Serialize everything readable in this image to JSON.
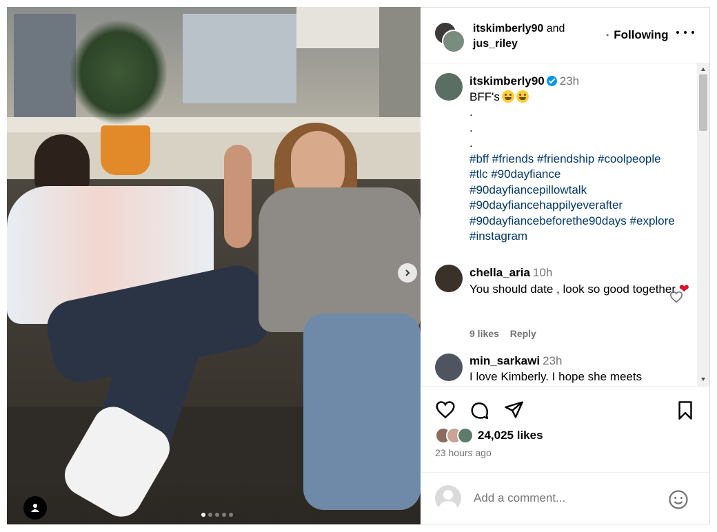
{
  "header": {
    "user1": "itskimberly90",
    "conj": "and",
    "user2": "jus_riley",
    "follow_label": "Following"
  },
  "caption": {
    "username": "itskimberly90",
    "time": "23h",
    "text": "BFF's",
    "dots": [
      ".",
      ".",
      "."
    ],
    "hashtags": [
      "#bff",
      "#friends",
      "#friendship",
      "#coolpeople",
      "#tlc",
      "#90dayfiance",
      "#90dayfiancepillowtalk",
      "#90dayfiancehappilyeverafter",
      "#90dayfiancebeforethe90days",
      "#explore",
      "#instagram"
    ]
  },
  "comments": [
    {
      "username": "chella_aria",
      "time": "10h",
      "text": "You should date , look so good together",
      "likes": "9 likes",
      "reply": "Reply"
    },
    {
      "username": "min_sarkawi",
      "time": "23h",
      "text": "I love Kimberly. I hope she meets"
    }
  ],
  "post": {
    "likes": "24,025 likes",
    "posted": "23 hours ago"
  },
  "comment_input": {
    "placeholder": "Add a comment..."
  },
  "carousel": {
    "count": 5,
    "active": 0
  },
  "colors": {
    "hashtag": "#00376b",
    "verified": "#0095f6",
    "muted": "#737373",
    "heart": "#e0112b"
  },
  "icons": [
    "user-tag-icon",
    "chevron-right-icon",
    "more-icon",
    "heart-icon",
    "comment-icon",
    "share-icon",
    "bookmark-icon",
    "emoji-icon",
    "verified-icon"
  ]
}
